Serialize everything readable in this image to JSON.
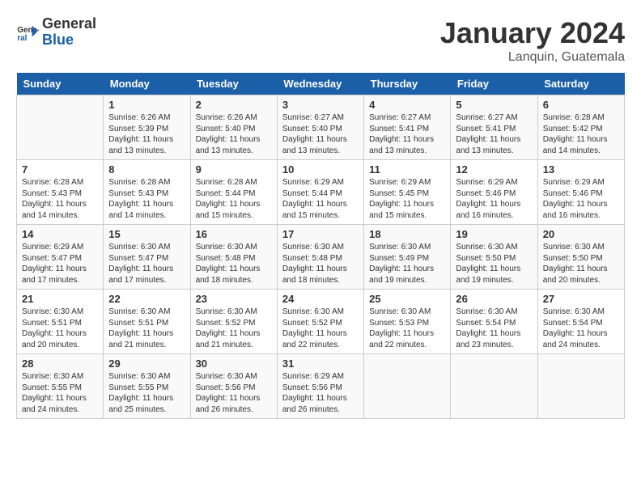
{
  "header": {
    "logo_line1": "General",
    "logo_line2": "Blue",
    "month": "January 2024",
    "location": "Lanquin, Guatemala"
  },
  "weekdays": [
    "Sunday",
    "Monday",
    "Tuesday",
    "Wednesday",
    "Thursday",
    "Friday",
    "Saturday"
  ],
  "weeks": [
    [
      {
        "day": "",
        "info": ""
      },
      {
        "day": "1",
        "info": "Sunrise: 6:26 AM\nSunset: 5:39 PM\nDaylight: 11 hours\nand 13 minutes."
      },
      {
        "day": "2",
        "info": "Sunrise: 6:26 AM\nSunset: 5:40 PM\nDaylight: 11 hours\nand 13 minutes."
      },
      {
        "day": "3",
        "info": "Sunrise: 6:27 AM\nSunset: 5:40 PM\nDaylight: 11 hours\nand 13 minutes."
      },
      {
        "day": "4",
        "info": "Sunrise: 6:27 AM\nSunset: 5:41 PM\nDaylight: 11 hours\nand 13 minutes."
      },
      {
        "day": "5",
        "info": "Sunrise: 6:27 AM\nSunset: 5:41 PM\nDaylight: 11 hours\nand 13 minutes."
      },
      {
        "day": "6",
        "info": "Sunrise: 6:28 AM\nSunset: 5:42 PM\nDaylight: 11 hours\nand 14 minutes."
      }
    ],
    [
      {
        "day": "7",
        "info": "Sunrise: 6:28 AM\nSunset: 5:43 PM\nDaylight: 11 hours\nand 14 minutes."
      },
      {
        "day": "8",
        "info": "Sunrise: 6:28 AM\nSunset: 5:43 PM\nDaylight: 11 hours\nand 14 minutes."
      },
      {
        "day": "9",
        "info": "Sunrise: 6:28 AM\nSunset: 5:44 PM\nDaylight: 11 hours\nand 15 minutes."
      },
      {
        "day": "10",
        "info": "Sunrise: 6:29 AM\nSunset: 5:44 PM\nDaylight: 11 hours\nand 15 minutes."
      },
      {
        "day": "11",
        "info": "Sunrise: 6:29 AM\nSunset: 5:45 PM\nDaylight: 11 hours\nand 15 minutes."
      },
      {
        "day": "12",
        "info": "Sunrise: 6:29 AM\nSunset: 5:46 PM\nDaylight: 11 hours\nand 16 minutes."
      },
      {
        "day": "13",
        "info": "Sunrise: 6:29 AM\nSunset: 5:46 PM\nDaylight: 11 hours\nand 16 minutes."
      }
    ],
    [
      {
        "day": "14",
        "info": "Sunrise: 6:29 AM\nSunset: 5:47 PM\nDaylight: 11 hours\nand 17 minutes."
      },
      {
        "day": "15",
        "info": "Sunrise: 6:30 AM\nSunset: 5:47 PM\nDaylight: 11 hours\nand 17 minutes."
      },
      {
        "day": "16",
        "info": "Sunrise: 6:30 AM\nSunset: 5:48 PM\nDaylight: 11 hours\nand 18 minutes."
      },
      {
        "day": "17",
        "info": "Sunrise: 6:30 AM\nSunset: 5:48 PM\nDaylight: 11 hours\nand 18 minutes."
      },
      {
        "day": "18",
        "info": "Sunrise: 6:30 AM\nSunset: 5:49 PM\nDaylight: 11 hours\nand 19 minutes."
      },
      {
        "day": "19",
        "info": "Sunrise: 6:30 AM\nSunset: 5:50 PM\nDaylight: 11 hours\nand 19 minutes."
      },
      {
        "day": "20",
        "info": "Sunrise: 6:30 AM\nSunset: 5:50 PM\nDaylight: 11 hours\nand 20 minutes."
      }
    ],
    [
      {
        "day": "21",
        "info": "Sunrise: 6:30 AM\nSunset: 5:51 PM\nDaylight: 11 hours\nand 20 minutes."
      },
      {
        "day": "22",
        "info": "Sunrise: 6:30 AM\nSunset: 5:51 PM\nDaylight: 11 hours\nand 21 minutes."
      },
      {
        "day": "23",
        "info": "Sunrise: 6:30 AM\nSunset: 5:52 PM\nDaylight: 11 hours\nand 21 minutes."
      },
      {
        "day": "24",
        "info": "Sunrise: 6:30 AM\nSunset: 5:52 PM\nDaylight: 11 hours\nand 22 minutes."
      },
      {
        "day": "25",
        "info": "Sunrise: 6:30 AM\nSunset: 5:53 PM\nDaylight: 11 hours\nand 22 minutes."
      },
      {
        "day": "26",
        "info": "Sunrise: 6:30 AM\nSunset: 5:54 PM\nDaylight: 11 hours\nand 23 minutes."
      },
      {
        "day": "27",
        "info": "Sunrise: 6:30 AM\nSunset: 5:54 PM\nDaylight: 11 hours\nand 24 minutes."
      }
    ],
    [
      {
        "day": "28",
        "info": "Sunrise: 6:30 AM\nSunset: 5:55 PM\nDaylight: 11 hours\nand 24 minutes."
      },
      {
        "day": "29",
        "info": "Sunrise: 6:30 AM\nSunset: 5:55 PM\nDaylight: 11 hours\nand 25 minutes."
      },
      {
        "day": "30",
        "info": "Sunrise: 6:30 AM\nSunset: 5:56 PM\nDaylight: 11 hours\nand 26 minutes."
      },
      {
        "day": "31",
        "info": "Sunrise: 6:29 AM\nSunset: 5:56 PM\nDaylight: 11 hours\nand 26 minutes."
      },
      {
        "day": "",
        "info": ""
      },
      {
        "day": "",
        "info": ""
      },
      {
        "day": "",
        "info": ""
      }
    ]
  ]
}
